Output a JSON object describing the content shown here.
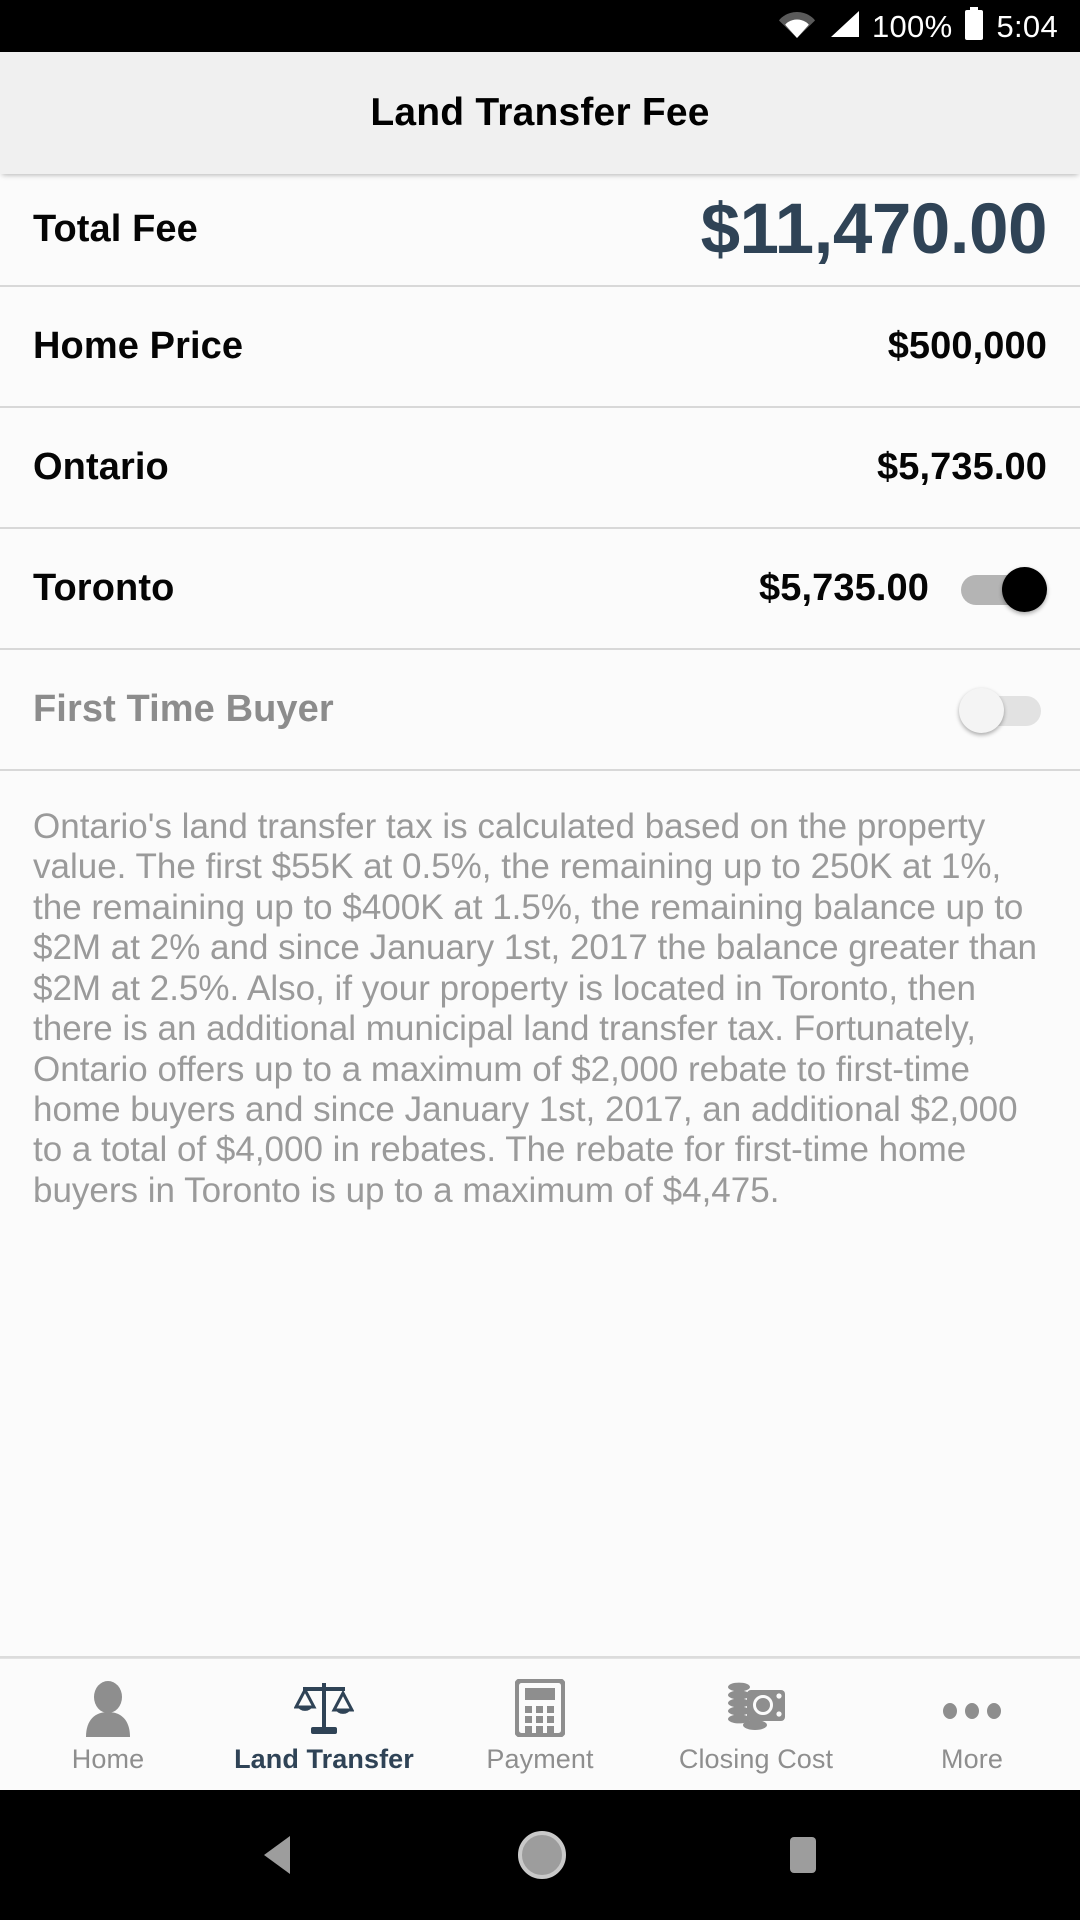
{
  "status_bar": {
    "wifi_icon": "wifi-icon",
    "signal_icon": "cellular-signal-icon",
    "battery_percent": "100%",
    "battery_icon": "battery-full-icon",
    "time": "5:04"
  },
  "app_bar": {
    "title": "Land Transfer Fee"
  },
  "rows": [
    {
      "label": "Total Fee",
      "value": "$11,470.00",
      "emphasis": true,
      "toggle": null
    },
    {
      "label": "Home Price",
      "value": "$500,000",
      "emphasis": false,
      "toggle": null
    },
    {
      "label": "Ontario",
      "value": "$5,735.00",
      "emphasis": false,
      "toggle": null
    },
    {
      "label": "Toronto",
      "value": "$5,735.00",
      "emphasis": false,
      "toggle": "on"
    },
    {
      "label": "First Time Buyer",
      "value": "",
      "emphasis": false,
      "toggle": "off",
      "disabled": true
    }
  ],
  "description": "Ontario's land transfer tax is calculated based on the property value. The first $55K at 0.5%, the remaining up to 250K at 1%, the remaining up to $400K at 1.5%, the remaining balance up to $2M at 2% and since January 1st, 2017 the balance greater than $2M at 2.5%. Also, if your property is located in Toronto, then there is an additional municipal land transfer tax. Fortunately, Ontario offers up to a maximum of $2,000 rebate to first-time home buyers and since January 1st, 2017, an additional $2,000 to a total of $4,000 in rebates. The rebate for first-time home buyers in Toronto is up to a maximum of $4,475.",
  "tabs": [
    {
      "label": "Home",
      "icon": "person-icon",
      "active": false
    },
    {
      "label": "Land Transfer",
      "icon": "scales-icon",
      "active": true
    },
    {
      "label": "Payment",
      "icon": "calculator-icon",
      "active": false
    },
    {
      "label": "Closing Cost",
      "icon": "money-icon",
      "active": false
    },
    {
      "label": "More",
      "icon": "ellipsis-icon",
      "active": false
    }
  ],
  "nav_bar": {
    "back": "back-triangle-icon",
    "home": "home-circle-icon",
    "recents": "recents-square-icon"
  },
  "colors": {
    "accent": "#2f4356",
    "muted_text": "#9a9a9a",
    "tab_inactive": "#8e8e8e",
    "row_border": "#d8d8d8",
    "appbar_bg": "#f0f0f0"
  }
}
